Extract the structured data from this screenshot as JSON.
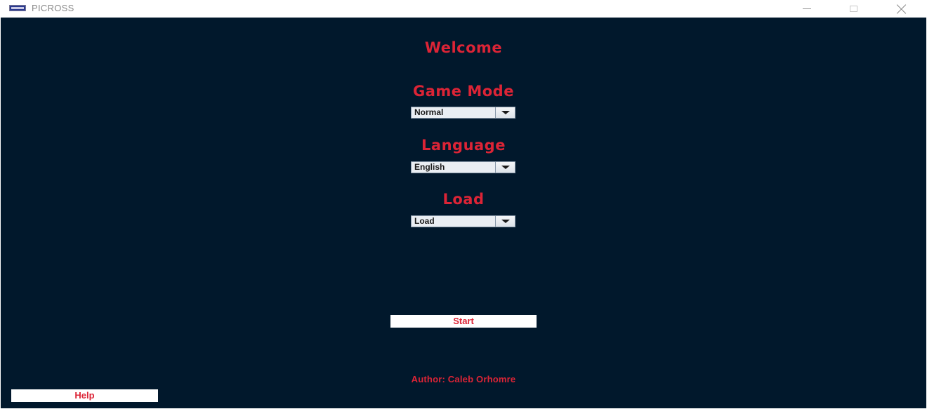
{
  "window": {
    "title": "PICROSS",
    "app_icon": "picross-app-icon",
    "controls": {
      "minimize_icon": "minimize-icon",
      "maximize_icon": "maximize-icon",
      "close_icon": "close-icon"
    }
  },
  "menu": {
    "welcome": "Welcome",
    "game_mode": {
      "heading": "Game Mode",
      "selected": "Normal"
    },
    "language": {
      "heading": "Language",
      "selected": "English"
    },
    "load": {
      "heading": "Load",
      "selected": "Load"
    },
    "start_label": "Start",
    "author": "Author: Caleb Orhomre",
    "help_label": "Help"
  },
  "colors": {
    "background": "#01182c",
    "accent": "#dc2436",
    "button_bg": "#ffffff"
  }
}
